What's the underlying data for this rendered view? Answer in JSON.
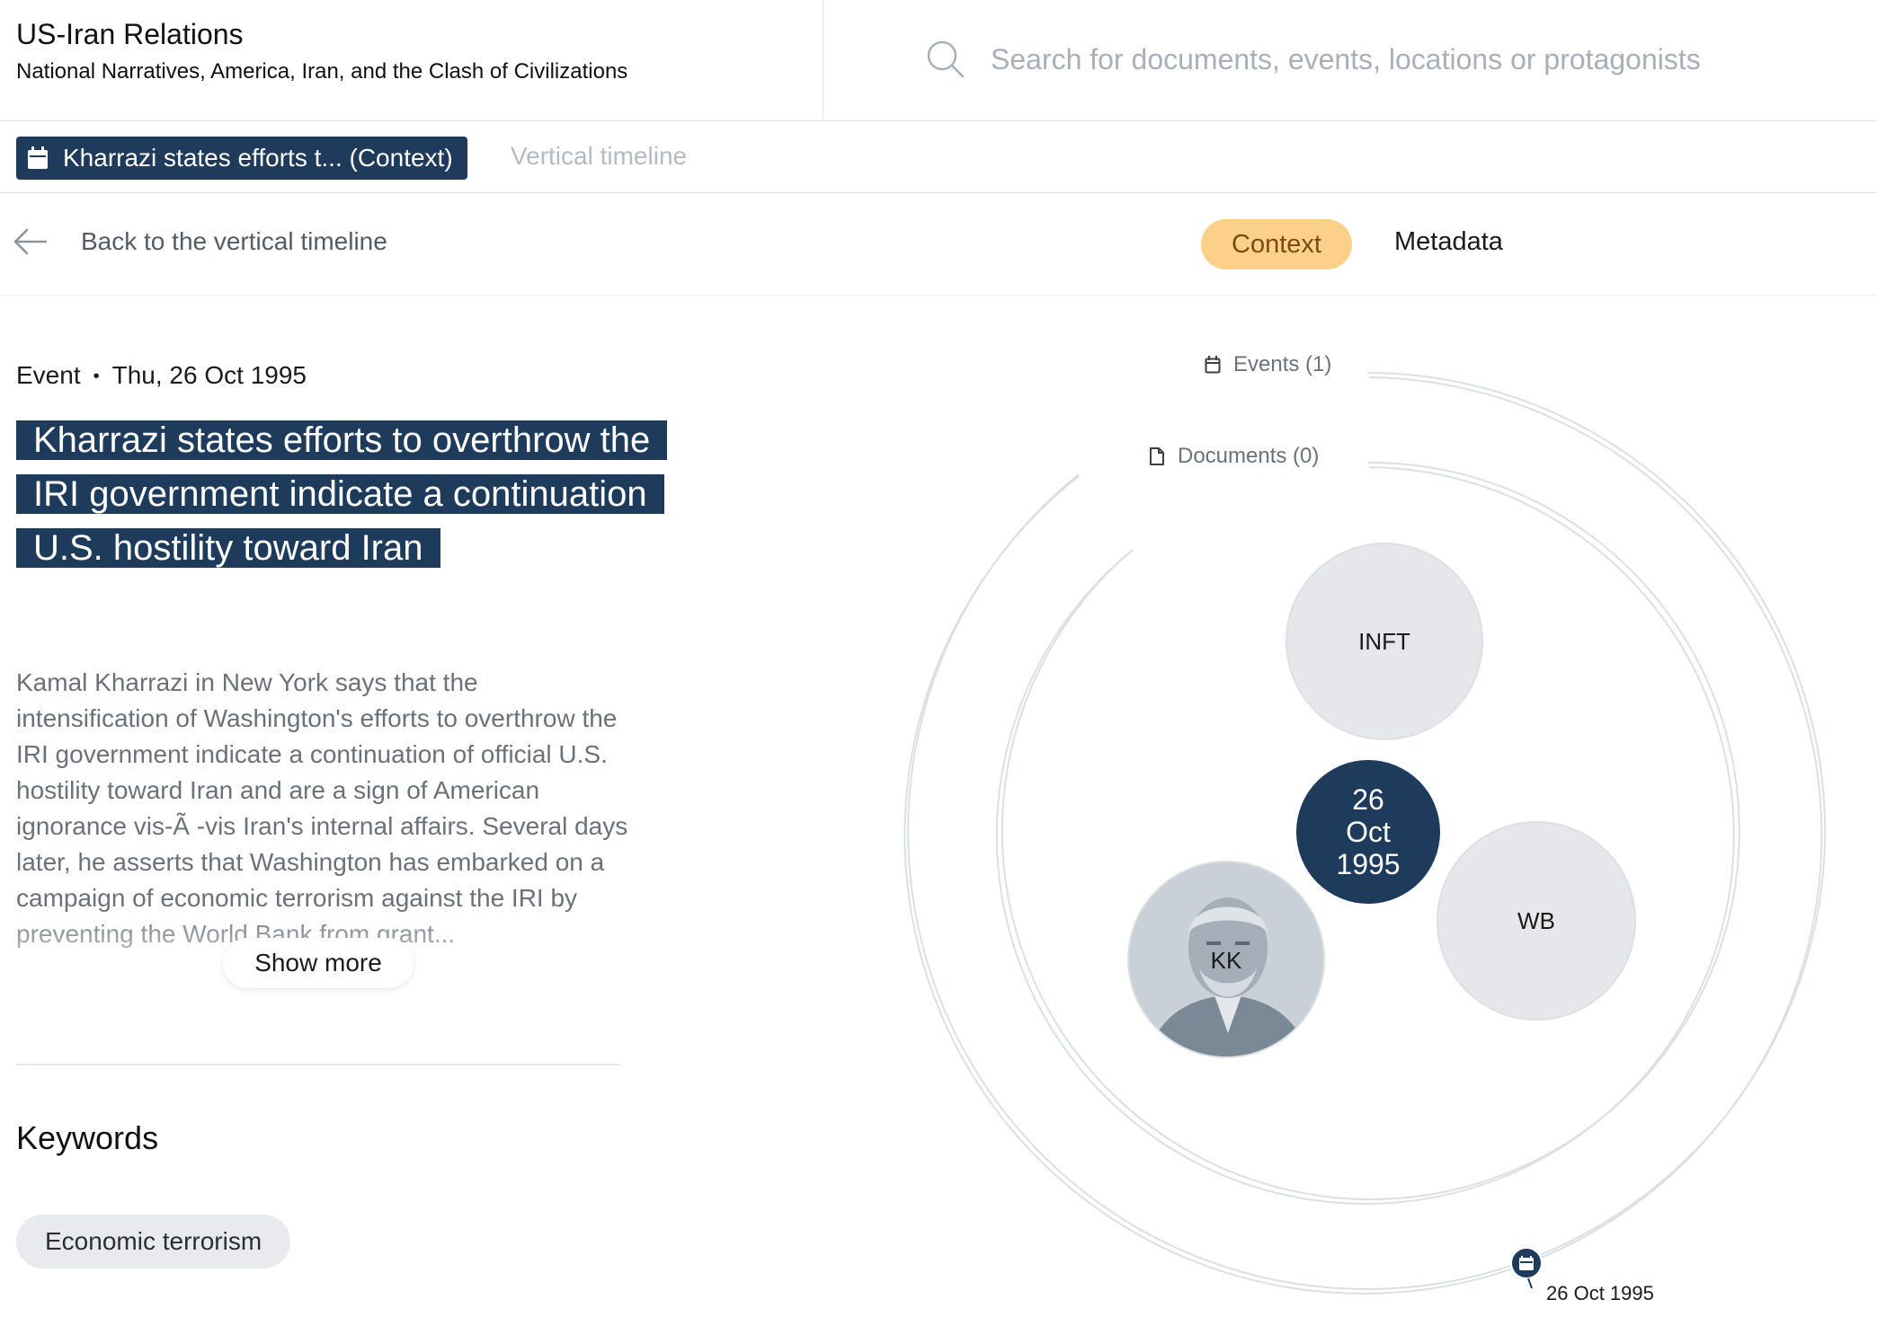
{
  "header": {
    "title": "US-Iran Relations",
    "subtitle": "National Narratives, America, Iran, and the Clash of Civilizations",
    "search_placeholder": "Search for documents, events, locations or protagonists"
  },
  "tabs": {
    "active_label": "Kharrazi states efforts t... (Context)",
    "inactive_label": "Vertical timeline"
  },
  "nav": {
    "back_label": "Back to the vertical timeline",
    "context_label": "Context",
    "metadata_label": "Metadata"
  },
  "event": {
    "type": "Event",
    "date": "Thu, 26 Oct 1995",
    "title": "Kharrazi states efforts to overthrow the IRI government indicate a continuation U.S. hostility toward Iran",
    "description": "Kamal Kharrazi in New York says that the intensification of Washington's efforts to overthrow the IRI government indicate a continuation of official U.S. hostility toward Iran and are a sign of American ignorance vis-Ã -vis Iran's internal affairs. Several days later, he asserts that Washington has embarked on a campaign of economic terrorism against the IRI by preventing the World Bank from grant...",
    "show_more_label": "Show more"
  },
  "keywords": {
    "heading": "Keywords",
    "items": [
      "Economic terrorism"
    ]
  },
  "viz": {
    "events_label": "Events (1)",
    "documents_label": "Documents (0)",
    "bubbles": {
      "inft": "INFT",
      "wb": "WB",
      "kk": "KK"
    },
    "center_date": {
      "day": "26",
      "month": "Oct",
      "year": "1995"
    },
    "marker_label": "26 Oct 1995"
  },
  "colors": {
    "accent_navy": "#1f3b5c",
    "context_pill": "#fdd08a",
    "bubble_gray": "#e5e7ea"
  }
}
